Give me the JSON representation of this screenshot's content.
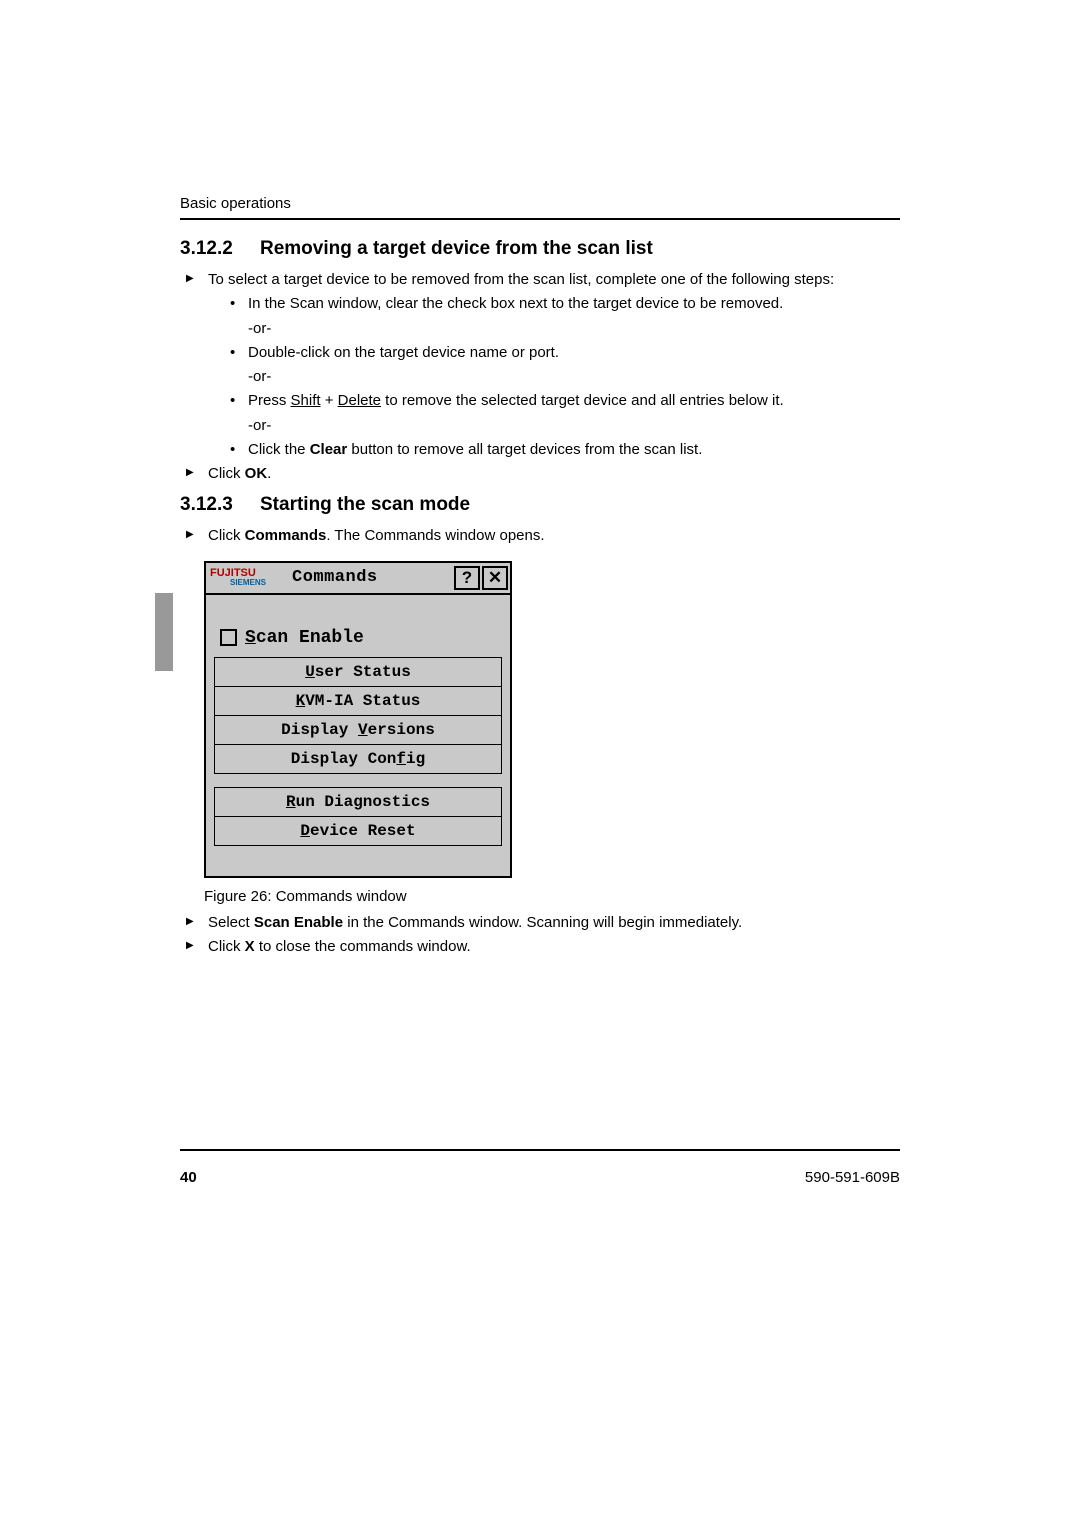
{
  "running_header": "Basic operations",
  "section_3_12_2": {
    "num": "3.12.2",
    "title": "Removing a target device from the scan list",
    "step1": "To select a target device to be removed from the scan list, complete one of the following steps:",
    "bullet1": "In the Scan window, clear the check box next to the target device to be removed.",
    "or": "-or-",
    "bullet2": "Double-click on the target device name or port.",
    "bullet3a": "Press ",
    "bullet3_shift": "Shift",
    "bullet3b": " + ",
    "bullet3_delete": "Delete",
    "bullet3c": " to remove the selected target device and all entries below it.",
    "bullet4a": "Click the ",
    "bullet4_clear": "Clear",
    "bullet4b": " button to remove all target devices from the scan list.",
    "step2a": "Click ",
    "step2_ok": "OK",
    "step2b": "."
  },
  "section_3_12_3": {
    "num": "3.12.3",
    "title": "Starting the scan mode",
    "step1a": "Click ",
    "step1_cmd": "Commands",
    "step1b": ". The Commands window opens.",
    "figure_caption": "Figure 26: Commands window",
    "step2a": "Select ",
    "step2_scan": "Scan Enable",
    "step2b": " in the Commands window. Scanning will begin immediately.",
    "step3a": "Click ",
    "step3_x": "X",
    "step3b": " to close the commands window."
  },
  "commands_window": {
    "logo_top": "FUJITSU",
    "logo_bottom": "SIEMENS",
    "title": "Commands",
    "help": "?",
    "close": "✕",
    "scan_pre": "S",
    "scan_post": "can Enable",
    "items": {
      "user_status_pre": "U",
      "user_status_post": "ser Status",
      "kvm_pre": "K",
      "kvm_post": "VM-IA Status",
      "disp_ver_a": "Display ",
      "disp_ver_u": "V",
      "disp_ver_b": "ersions",
      "disp_cfg_a": "Display Con",
      "disp_cfg_u": "f",
      "disp_cfg_b": "ig",
      "run_diag_pre": "R",
      "run_diag_post": "un Diagnostics",
      "dev_reset_pre": "D",
      "dev_reset_post": "evice Reset"
    }
  },
  "footer": {
    "page": "40",
    "docnum": "590-591-609B"
  }
}
